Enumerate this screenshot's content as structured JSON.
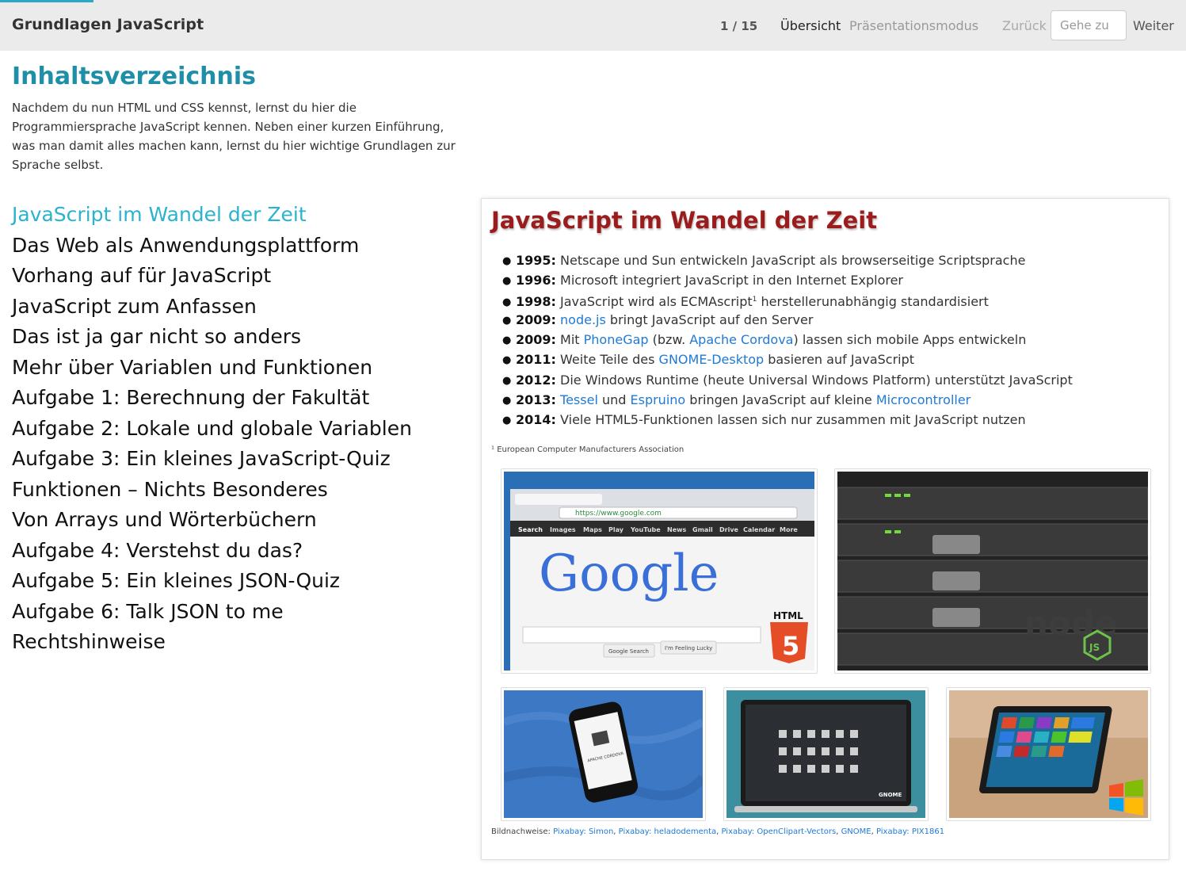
{
  "header": {
    "title": "Grundlagen JavaScript",
    "page_counter": "1 / 15",
    "overview_label": "Übersicht",
    "presentation_label": "Präsentationsmodus",
    "back_label": "Zurück",
    "goto_placeholder": "Gehe zu",
    "next_label": "Weiter"
  },
  "toc": {
    "heading": "Inhaltsverzeichnis",
    "intro": "Nachdem du nun HTML und CSS kennst, lernst du hier die Programmiersprache JavaScript kennen. Neben einer kurzen Einführung, was man damit alles machen kann, lernst du hier wichtige Grundlagen zur Sprache selbst.",
    "items": [
      "JavaScript im Wandel der Zeit",
      "Das Web als Anwendungsplattform",
      "Vorhang auf für JavaScript",
      "JavaScript zum Anfassen",
      "Das ist ja gar nicht so anders",
      "Mehr über Variablen und Funktionen",
      "Aufgabe 1: Berechnung der Fakultät",
      "Aufgabe 2: Lokale und globale Variablen",
      "Aufgabe 3: Ein kleines JavaScript-Quiz",
      "Funktionen – Nichts Besonderes",
      "Von Arrays und Wörterbüchern",
      "Aufgabe 4: Verstehst du das?",
      "Aufgabe 5: Ein kleines JSON-Quiz",
      "Aufgabe 6: Talk JSON to me",
      "Rechtshinweise"
    ]
  },
  "slide": {
    "title": "JavaScript im Wandel der Zeit",
    "timeline": [
      {
        "year": "1995:",
        "pre": " Netscape und Sun entwickeln JavaScript als browserseitige Scriptsprache"
      },
      {
        "year": "1996:",
        "pre": " Microsoft integriert JavaScript in den Internet Explorer"
      },
      {
        "year": "1998:",
        "pre": " JavaScript wird als ECMAscript",
        "sup": "1",
        "post": " herstellerunabhängig standardisiert"
      },
      {
        "year": "2009:",
        "pre": " ",
        "link1": "node.js",
        "post": " bringt JavaScript auf den Server"
      },
      {
        "year": "2009:",
        "pre": " Mit ",
        "link1": "PhoneGap",
        "mid": " (bzw. ",
        "link2": "Apache Cordova",
        "post": ") lassen sich mobile Apps entwickeln"
      },
      {
        "year": "2011:",
        "pre": " Weite Teile des ",
        "link1": "GNOME-Desktop",
        "post": " basieren auf JavaScript"
      },
      {
        "year": "2012:",
        "pre": " Die Windows Runtime (heute Universal Windows Platform) unterstützt JavaScript"
      },
      {
        "year": "2013:",
        "pre": " ",
        "link1": "Tessel",
        "mid": " und ",
        "link2": "Espruino",
        "mid2": " bringen JavaScript auf kleine ",
        "link3": "Microcontroller"
      },
      {
        "year": "2014:",
        "pre": " Viele HTML5-Funktionen lassen sich nur zusammen mit JavaScript nutzen"
      }
    ],
    "footnote": "¹ European Computer Manufacturers Association",
    "credits_label": "Bildnachweise:",
    "credits": [
      "Pixabay: Simon",
      "Pixabay: heladodementa",
      "Pixabay: OpenClipart-Vectors",
      "GNOME",
      "Pixabay: PIX1861"
    ],
    "image_texts": {
      "google_logo": "Google",
      "google_url": "https://www.google.com",
      "google_search_btn": "Google Search",
      "google_lucky_btn": "I'm Feeling Lucky",
      "html5_badge": "HTML",
      "html5_number": "5",
      "node_logo": "node",
      "node_js": "JS",
      "cordova_text": "APACHE CORDOVA",
      "gnome_text": "GNOME",
      "google_tabs": [
        "Search",
        "Images",
        "Maps",
        "Play",
        "YouTube",
        "News",
        "Gmail",
        "Drive",
        "Calendar",
        "More"
      ]
    }
  },
  "colors": {
    "accent": "#2ab3cf",
    "heading": "#1f8fa8",
    "slide_title": "#9b1c1c",
    "link": "#1e7ad6"
  }
}
